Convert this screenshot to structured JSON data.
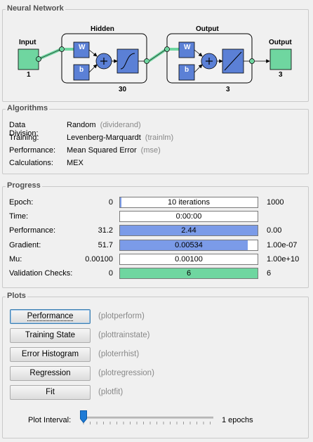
{
  "sections": {
    "network": "Neural Network",
    "algorithms": "Algorithms",
    "progress": "Progress",
    "plots": "Plots"
  },
  "network": {
    "input_label": "Input",
    "input_size": "1",
    "hidden_label": "Hidden",
    "hidden_size": "30",
    "output_layer_label": "Output",
    "output_layer_size": "3",
    "output_label": "Output",
    "output_size": "3",
    "weight_label": "W",
    "bias_label": "b"
  },
  "algorithms": [
    {
      "key": "Data Division:",
      "value": "Random",
      "fn": "(dividerand)"
    },
    {
      "key": "Training:",
      "value": "Levenberg-Marquardt",
      "fn": "(trainlm)"
    },
    {
      "key": "Performance:",
      "value": "Mean Squared Error",
      "fn": "(mse)"
    },
    {
      "key": "Calculations:",
      "value": "MEX",
      "fn": ""
    }
  ],
  "progress": [
    {
      "label": "Epoch:",
      "start": "0",
      "text": "10 iterations",
      "end": "1000",
      "fill": 0.01,
      "color": "#7b9be8"
    },
    {
      "label": "Time:",
      "start": "",
      "text": "0:00:00",
      "end": "",
      "fill": 0,
      "color": "#7b9be8"
    },
    {
      "label": "Performance:",
      "start": "31.2",
      "text": "2.44",
      "end": "0.00",
      "fill": 1.0,
      "color": "#7b9be8"
    },
    {
      "label": "Gradient:",
      "start": "51.7",
      "text": "0.00534",
      "end": "1.00e-07",
      "fill": 0.93,
      "color": "#7b9be8"
    },
    {
      "label": "Mu:",
      "start": "0.00100",
      "text": "0.00100",
      "end": "1.00e+10",
      "fill": 0,
      "color": "#7b9be8"
    },
    {
      "label": "Validation Checks:",
      "start": "0",
      "text": "6",
      "end": "6",
      "fill": 1.0,
      "color": "#6fd6a0"
    }
  ],
  "plots": [
    {
      "label": "Performance",
      "fn": "(plotperform)"
    },
    {
      "label": "Training State",
      "fn": "(plottrainstate)"
    },
    {
      "label": "Error Histogram",
      "fn": "(ploterrhist)"
    },
    {
      "label": "Regression",
      "fn": "(plotregression)"
    },
    {
      "label": "Fit",
      "fn": "(plotfit)"
    }
  ],
  "plot_interval": {
    "label": "Plot Interval:",
    "value_text": "1 epochs",
    "slider_fraction": 0.0
  },
  "colors": {
    "node": "#6fd6a0",
    "layer_box": "#5b80d6",
    "panel": "#e8e8e8"
  }
}
